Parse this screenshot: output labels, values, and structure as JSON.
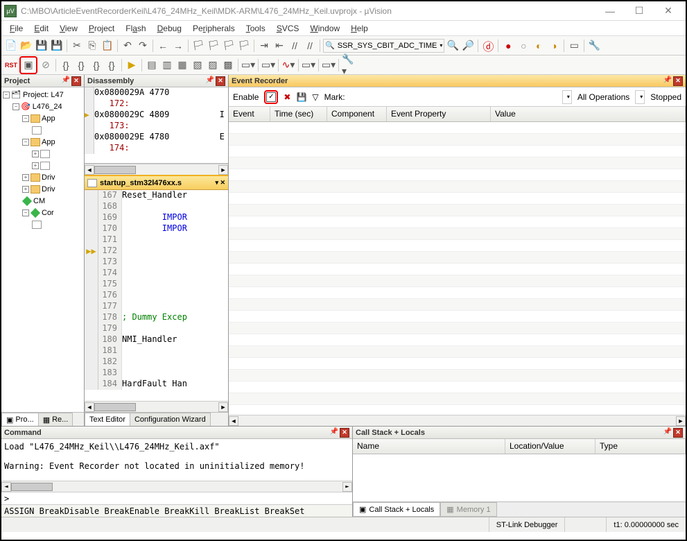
{
  "title": "C:\\MBO\\ArticleEventRecorderKeil\\L476_24MHz_Keil\\MDK-ARM\\L476_24MHz_Keil.uvprojx - µVision",
  "menu": [
    "File",
    "Edit",
    "View",
    "Project",
    "Flash",
    "Debug",
    "Peripherals",
    "Tools",
    "SVCS",
    "Window",
    "Help"
  ],
  "toolbar": {
    "search_selected": "SSR_SYS_CBIT_ADC_TIME",
    "rst": "RST"
  },
  "project": {
    "header": "Project",
    "root": "Project: L47",
    "items": [
      {
        "label": "L476_24",
        "icon": "target",
        "indent": 1
      },
      {
        "label": "App",
        "icon": "folder",
        "indent": 2
      },
      {
        "label": "",
        "icon": "file",
        "indent": 3
      },
      {
        "label": "App",
        "icon": "folder",
        "indent": 2
      },
      {
        "label": "",
        "icon": "file",
        "indent": 3
      },
      {
        "label": "",
        "icon": "file",
        "indent": 3
      },
      {
        "label": "Driv",
        "icon": "folder",
        "indent": 2
      },
      {
        "label": "Driv",
        "icon": "folder",
        "indent": 2
      },
      {
        "label": "CM",
        "icon": "diamond",
        "indent": 2
      },
      {
        "label": "Cor",
        "icon": "diamond",
        "indent": 2
      },
      {
        "label": "",
        "icon": "file",
        "indent": 3
      }
    ],
    "tabs": [
      "Pro...",
      "Re..."
    ]
  },
  "disassembly": {
    "header": "Disassembly",
    "lines": [
      {
        "gutter": "",
        "text": "0x0800029A 4770"
      },
      {
        "gutter": "",
        "text": "   172:",
        "cls": "lnnum"
      },
      {
        "gutter": "▶",
        "text": "0x0800029C 4809          I"
      },
      {
        "gutter": "",
        "text": "   173:",
        "cls": "lnnum"
      },
      {
        "gutter": "",
        "text": "0x0800029E 4780          E"
      },
      {
        "gutter": "",
        "text": "   174:",
        "cls": "lnnum"
      }
    ]
  },
  "code": {
    "tab_name": "startup_stm32l476xx.s",
    "lines": [
      {
        "n": 167,
        "t": "Reset_Handler",
        "c": "label-black"
      },
      {
        "n": 168,
        "t": "",
        "c": ""
      },
      {
        "n": 169,
        "t": "        IMPOR",
        "c": "kw-blue"
      },
      {
        "n": 170,
        "t": "        IMPOR",
        "c": "kw-blue"
      },
      {
        "n": 171,
        "t": "",
        "c": ""
      },
      {
        "n": 172,
        "t": "",
        "c": "",
        "marker": "pc"
      },
      {
        "n": 173,
        "t": "",
        "c": ""
      },
      {
        "n": 174,
        "t": "",
        "c": ""
      },
      {
        "n": 175,
        "t": "",
        "c": ""
      },
      {
        "n": 176,
        "t": "",
        "c": ""
      },
      {
        "n": 177,
        "t": "",
        "c": ""
      },
      {
        "n": 178,
        "t": "; Dummy Excep",
        "c": "comment"
      },
      {
        "n": 179,
        "t": "",
        "c": ""
      },
      {
        "n": 180,
        "t": "NMI_Handler",
        "c": "label-black"
      },
      {
        "n": 181,
        "t": "",
        "c": ""
      },
      {
        "n": 182,
        "t": "",
        "c": ""
      },
      {
        "n": 183,
        "t": "",
        "c": ""
      },
      {
        "n": 184,
        "t": "HardFault Han",
        "c": "label-black"
      }
    ],
    "bottom_tabs": [
      "Text Editor",
      "Configuration Wizard"
    ]
  },
  "event_recorder": {
    "header": "Event Recorder",
    "enable_label": "Enable",
    "mark_label": "Mark:",
    "all_ops": "All Operations",
    "stopped": "Stopped",
    "cols": [
      "Event",
      "Time (sec)",
      "Component",
      "Event Property",
      "Value"
    ]
  },
  "command": {
    "header": "Command",
    "body": "Load \"L476_24MHz_Keil\\\\L476_24MHz_Keil.axf\"\n\nWarning: Event Recorder not located in uninitialized memory!",
    "prompt": ">",
    "hints": "ASSIGN BreakDisable BreakEnable BreakKill BreakList BreakSet"
  },
  "callstack": {
    "header": "Call Stack + Locals",
    "cols": [
      "Name",
      "Location/Value",
      "Type"
    ],
    "tabs": [
      "Call Stack + Locals",
      "Memory 1"
    ]
  },
  "status": {
    "debugger": "ST-Link Debugger",
    "time": "t1: 0.00000000 sec"
  }
}
